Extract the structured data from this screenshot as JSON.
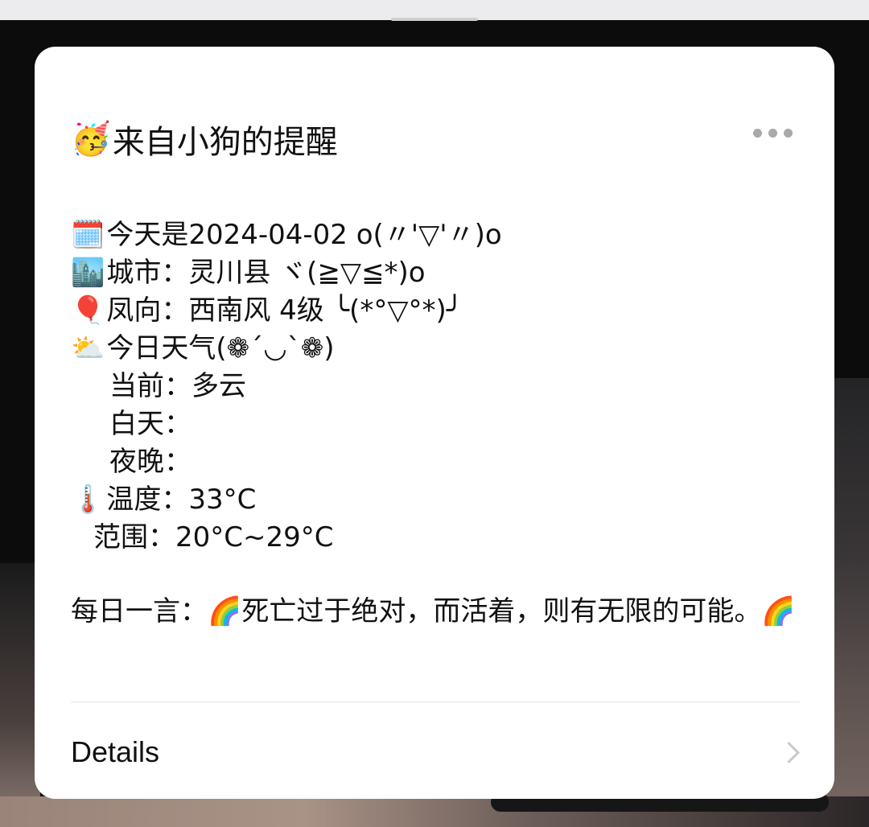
{
  "card": {
    "title_icon": "🥳",
    "title": "来自小狗的提醒",
    "more_icon": "more-dots-icon",
    "lines": [
      {
        "icon": "🗓️",
        "text": "今天是2024-04-02 o(〃'▽'〃)o"
      },
      {
        "icon": "🏙️",
        "text": "城市：灵川县 ヾ(≧▽≦*)o"
      },
      {
        "icon": "🎈",
        "text": "凤向：西南风 4级 ╰(*°▽°*)╯"
      },
      {
        "icon": "⛅",
        "text": "今日天气(❁´◡`❁)"
      },
      {
        "icon": "",
        "text": "当前：多云"
      },
      {
        "icon": "",
        "text": "白天："
      },
      {
        "icon": "",
        "text": "夜晚："
      },
      {
        "icon": "🌡️",
        "text": "温度：33°C"
      },
      {
        "icon": "",
        "text": "范围：20°C~29°C"
      }
    ],
    "quote_prefix": "每日一言：",
    "quote_icon": "🌈",
    "quote_text": "死亡过于绝对，而活着，则有无限的可能。",
    "quote_suffix_icon": "🌈",
    "details_label": "Details",
    "details_icon": "chevron-right-icon"
  }
}
